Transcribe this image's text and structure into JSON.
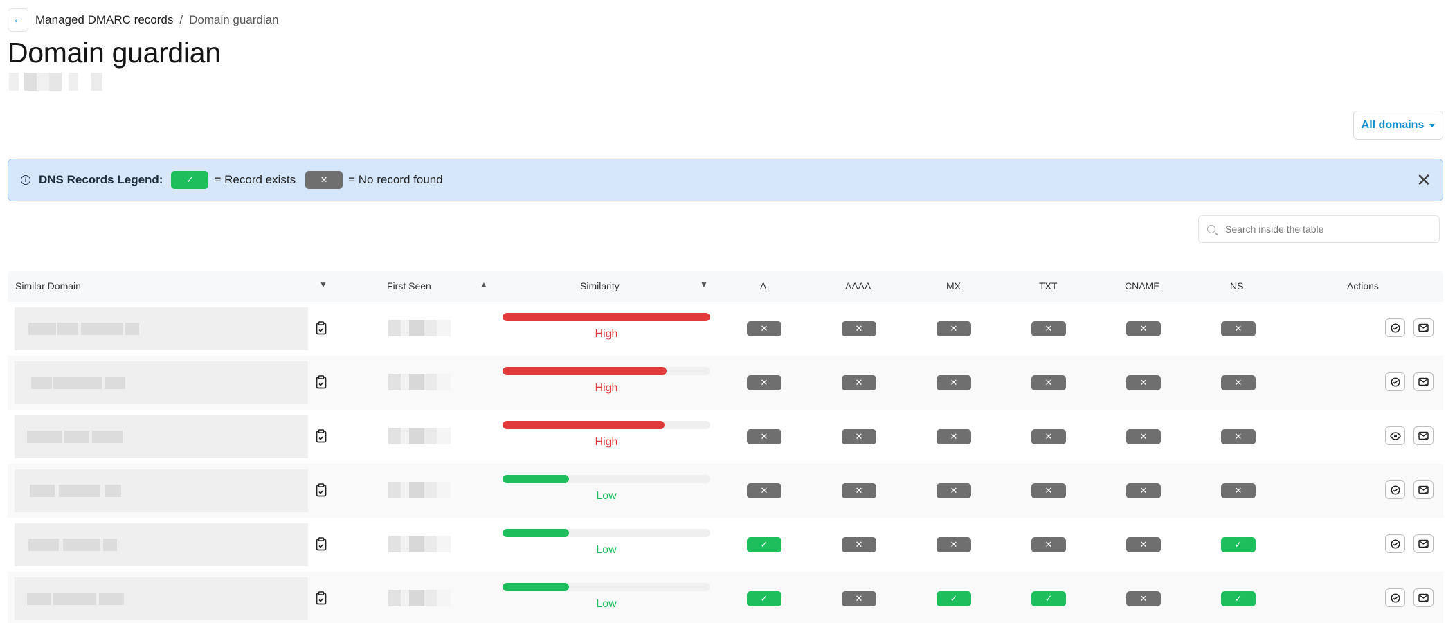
{
  "breadcrumb": {
    "back_icon": "←",
    "parent": "Managed DMARC records",
    "separator": "/",
    "current": "Domain guardian"
  },
  "page": {
    "title": "Domain guardian"
  },
  "filter": {
    "label": "All domains"
  },
  "legend": {
    "title": "DNS Records Legend:",
    "exists_text": "= Record exists",
    "missing_text": "= No record found",
    "close": "✕"
  },
  "search": {
    "placeholder": "Search inside the table"
  },
  "table": {
    "headers": {
      "domain": "Similar Domain",
      "first_seen": "First Seen",
      "similarity": "Similarity",
      "a": "A",
      "aaaa": "AAAA",
      "mx": "MX",
      "txt": "TXT",
      "cname": "CNAME",
      "ns": "NS",
      "actions": "Actions"
    },
    "sort_icons": {
      "domain": "▼",
      "first_seen": "▲",
      "similarity": "▼"
    },
    "rows": [
      {
        "similarity": "High",
        "similarity_pct": 100,
        "level": "high",
        "dns": [
          false,
          false,
          false,
          false,
          false,
          false
        ],
        "view_icon": "check-circle-icon"
      },
      {
        "similarity": "High",
        "similarity_pct": 79,
        "level": "high",
        "dns": [
          false,
          false,
          false,
          false,
          false,
          false
        ],
        "view_icon": "check-circle-icon"
      },
      {
        "similarity": "High",
        "similarity_pct": 78,
        "level": "high",
        "dns": [
          false,
          false,
          false,
          false,
          false,
          false
        ],
        "view_icon": "eye-icon"
      },
      {
        "similarity": "Low",
        "similarity_pct": 32,
        "level": "low",
        "dns": [
          false,
          false,
          false,
          false,
          false,
          false
        ],
        "view_icon": "check-circle-icon"
      },
      {
        "similarity": "Low",
        "similarity_pct": 32,
        "level": "low",
        "dns": [
          true,
          false,
          false,
          false,
          false,
          true
        ],
        "view_icon": "check-circle-icon"
      },
      {
        "similarity": "Low",
        "similarity_pct": 32,
        "level": "low",
        "dns": [
          true,
          false,
          true,
          true,
          false,
          true
        ],
        "view_icon": "check-circle-icon"
      }
    ]
  },
  "colors": {
    "high": "#e03a3a",
    "low": "#1cbf5c",
    "ok": "#1cbf5c",
    "missing": "#6f6f6f",
    "accent": "#0b8fd0"
  },
  "icons": {
    "ok": "✓",
    "missing": "✕"
  }
}
